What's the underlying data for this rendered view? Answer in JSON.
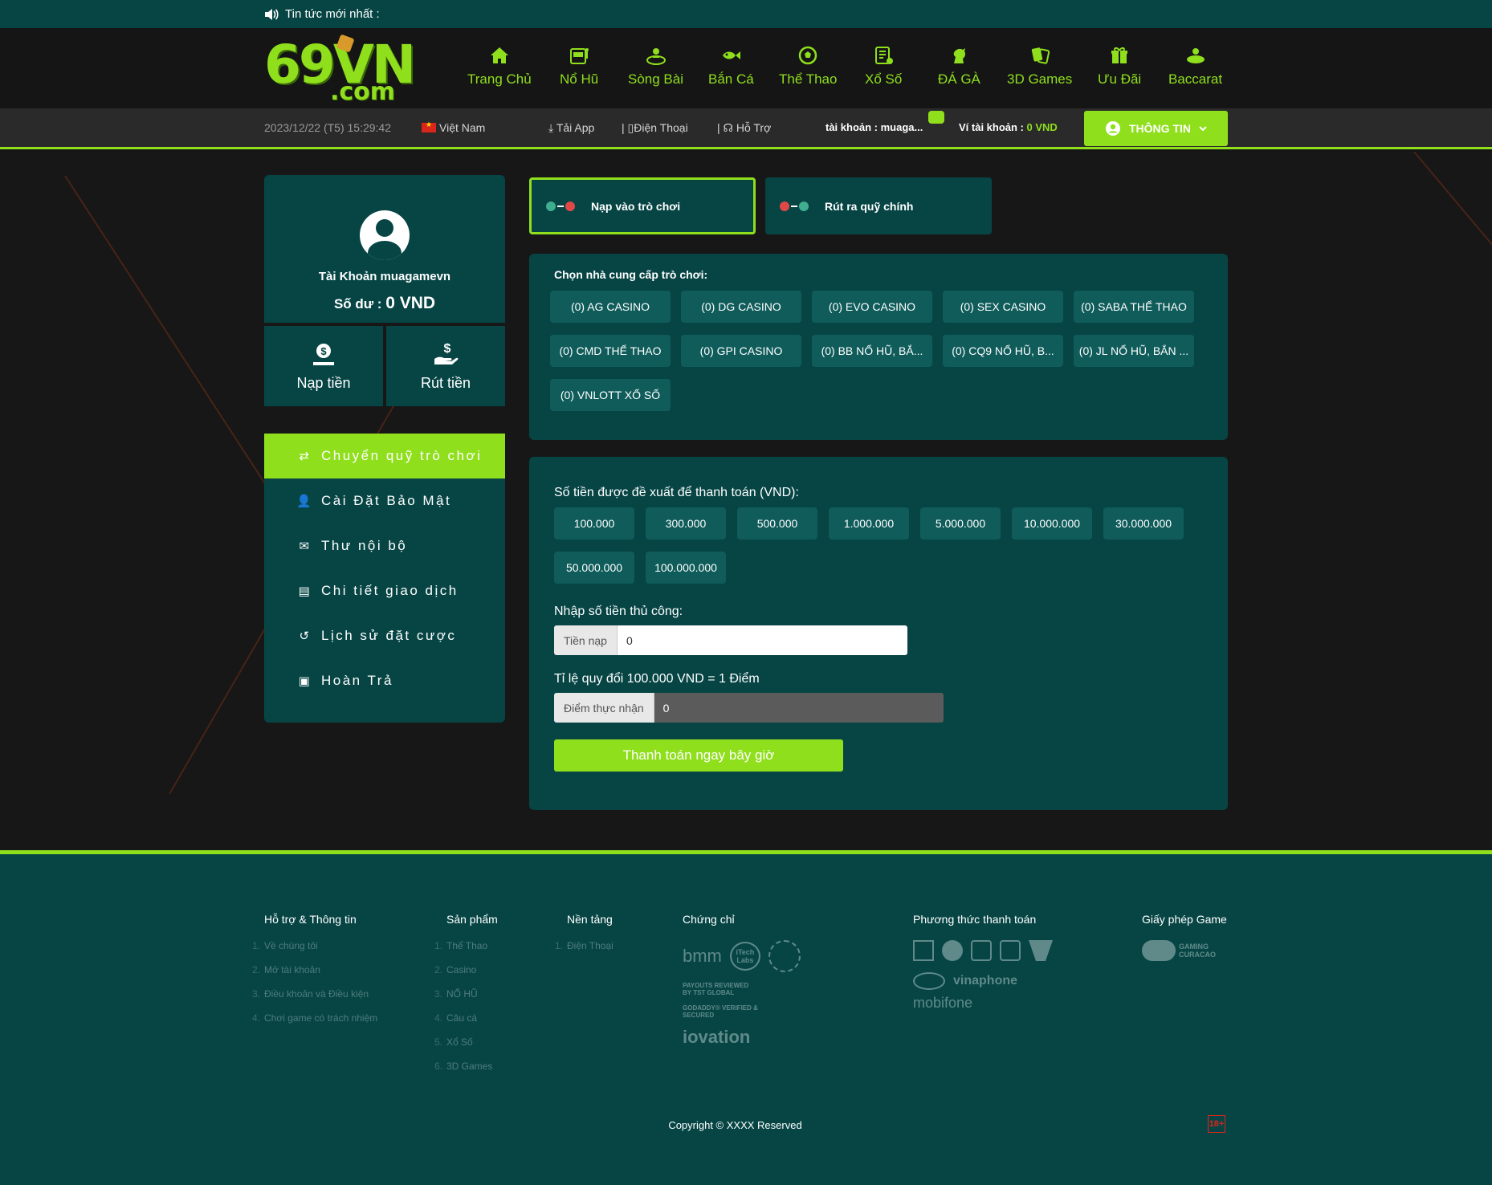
{
  "news": {
    "label": "Tin tức mới nhất :"
  },
  "logo": {
    "main": "69VN",
    "sub": ".com"
  },
  "nav": [
    {
      "label": "Trang Chủ",
      "icon": "home-icon"
    },
    {
      "label": "Nổ Hũ",
      "icon": "slot-machine-icon"
    },
    {
      "label": "Sòng Bài",
      "icon": "casino-dealer-icon"
    },
    {
      "label": "Bắn Cá",
      "icon": "fish-icon"
    },
    {
      "label": "Thể Thao",
      "icon": "soccer-ball-icon"
    },
    {
      "label": "Xổ Số",
      "icon": "lottery-icon"
    },
    {
      "label": "ĐÁ GÀ",
      "icon": "rooster-icon"
    },
    {
      "label": "3D Games",
      "icon": "game-cards-icon"
    },
    {
      "label": "Ưu Đãi",
      "icon": "gift-icon"
    },
    {
      "label": "Baccarat",
      "icon": "baccarat-icon"
    }
  ],
  "infobar": {
    "datetime": "2023/12/22 (T5) 15:29:42",
    "language": "Việt Nam",
    "download": "Tải App",
    "phone": "Điện Thoại",
    "support": "Hỗ Trợ",
    "account_label": "tài khoản : muaga...",
    "wallet_label": "Ví tài khoản : ",
    "wallet_value": "0 VND",
    "info_button": "THÔNG TIN"
  },
  "profile": {
    "account": "Tài Khoản muagamevn",
    "balance_label": "Số dư : ",
    "balance_value": "0 VND",
    "deposit": "Nạp tiền",
    "withdraw": "Rút tiền"
  },
  "menu": [
    {
      "label": "Chuyển quỹ trò chơi",
      "icon": "transfer-icon",
      "active": true
    },
    {
      "label": "Cài Đặt Bảo Mật",
      "icon": "user-lock-icon",
      "active": false
    },
    {
      "label": "Thư nội bộ",
      "icon": "envelope-icon",
      "active": false
    },
    {
      "label": "Chi tiết giao dịch",
      "icon": "clipboard-icon",
      "active": false
    },
    {
      "label": "Lịch sử đặt cược",
      "icon": "history-icon",
      "active": false
    },
    {
      "label": "Hoàn Trả",
      "icon": "money-icon",
      "active": false
    }
  ],
  "tabs": {
    "deposit": "Nạp vào trò chơi",
    "withdraw": "Rút ra quỹ chính"
  },
  "providers": {
    "title": "Chọn nhà cung cấp trò chơi:",
    "items": [
      "(0) AG CASINO",
      "(0) DG CASINO",
      "(0) EVO CASINO",
      "(0) SEX CASINO",
      "(0) SABA THỂ THAO",
      "(0) CMD THỂ THAO",
      "(0) GPI CASINO",
      "(0) BB NỔ HŨ, BẮ...",
      "(0) CQ9 NỔ HŨ, B...",
      "(0) JL NỔ HŨ, BẮN ...",
      "(0) VNLOTT XỔ SỐ"
    ]
  },
  "payment": {
    "suggest_label": "Số tiền được đề xuất để thanh toán (VND):",
    "amounts": [
      "100.000",
      "300.000",
      "500.000",
      "1.000.000",
      "5.000.000",
      "10.000.000",
      "30.000.000",
      "50.000.000",
      "100.000.000"
    ],
    "manual_label": "Nhập số tiền thủ công:",
    "input_addon": "Tiền nạp",
    "input_value": "0",
    "rate_label": "Tỉ lệ quy đổi 100.000 VND = 1 Điểm",
    "points_addon": "Điểm thực nhận",
    "points_value": "0",
    "pay_button": "Thanh toán ngay bây giờ"
  },
  "footer": {
    "support": {
      "title": "Hỗ trợ & Thông tin",
      "items": [
        "Về chúng tôi",
        "Mở tài khoản",
        "Điều khoản và Điều kiện",
        "Chơi game có trách nhiệm"
      ]
    },
    "products": {
      "title": "Sản phẩm",
      "items": [
        "Thể Thao",
        "Casino",
        "NỔ HŨ",
        "Câu cá",
        "Xổ Số",
        "3D Games"
      ]
    },
    "platform": {
      "title": "Nền tảng",
      "items": [
        "Điện Thoại"
      ]
    },
    "certs": {
      "title": "Chứng chỉ",
      "logos": [
        "bmm",
        "iTech Labs",
        "PAYOUTS REVIEWED BY TST GLOBAL",
        "GODADDY® VERIFIED & SECURED",
        "iovation"
      ]
    },
    "payments": {
      "title": "Phương thức thanh toán",
      "logos": [
        "vinaphone",
        "mobifone"
      ]
    },
    "license": {
      "title": "Giấy phép Game",
      "logo": "GAMING CURACAO"
    },
    "copyright": "Copyright © XXXX Reserved",
    "age": "18+"
  }
}
